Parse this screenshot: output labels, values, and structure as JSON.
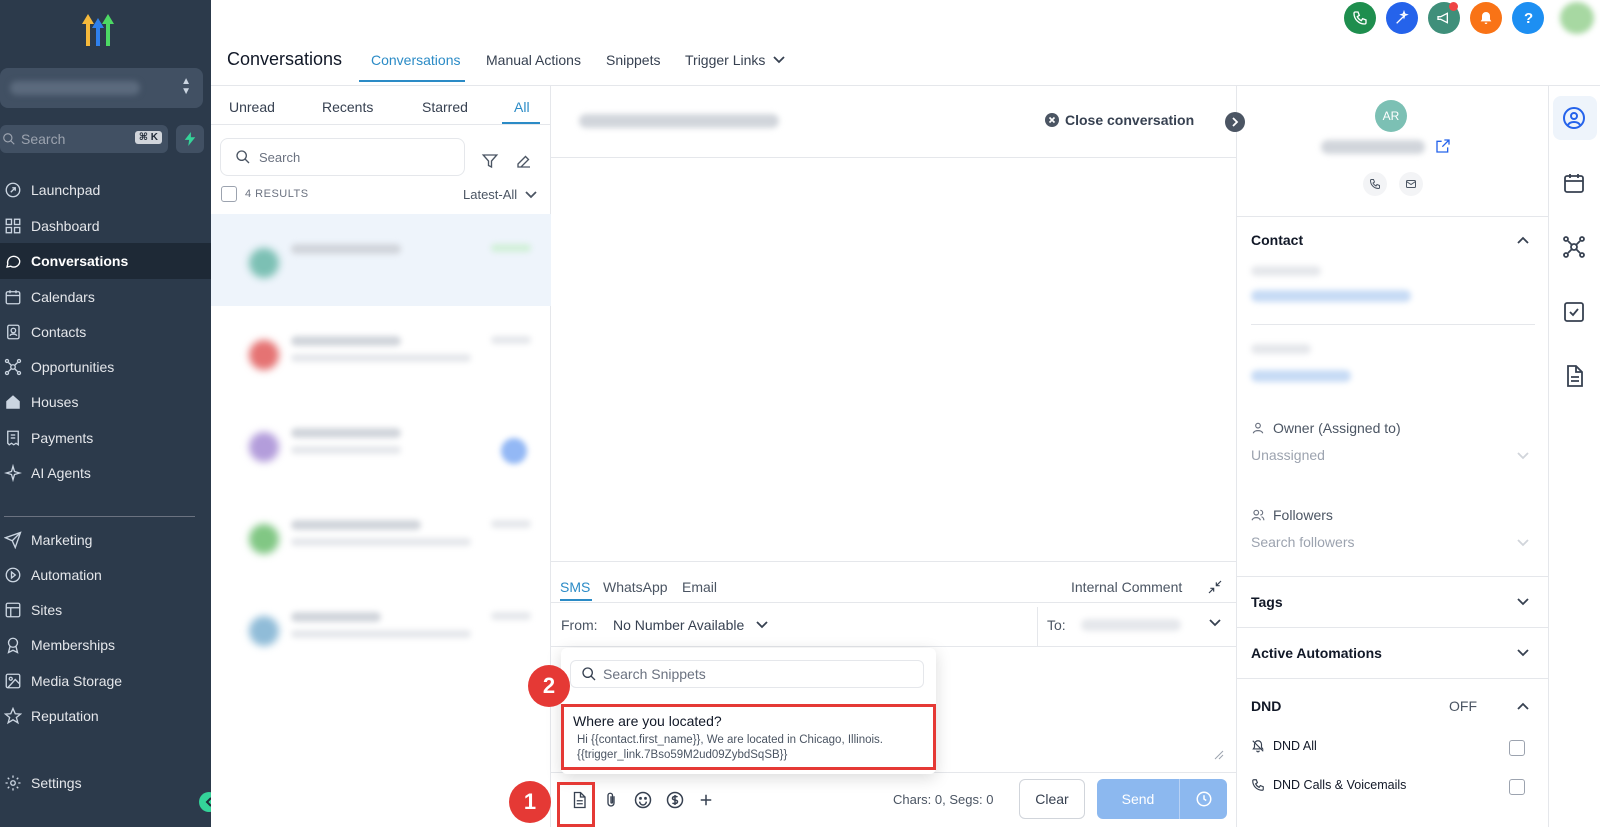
{
  "sidebar": {
    "search_placeholder": "Search",
    "search_shortcut": "⌘ K",
    "items": [
      {
        "label": "Launchpad",
        "icon": "rocket-icon"
      },
      {
        "label": "Dashboard",
        "icon": "grid-icon"
      },
      {
        "label": "Conversations",
        "icon": "chat-icon",
        "active": true
      },
      {
        "label": "Calendars",
        "icon": "calendar-icon"
      },
      {
        "label": "Contacts",
        "icon": "contacts-icon"
      },
      {
        "label": "Opportunities",
        "icon": "network-icon"
      },
      {
        "label": "Houses",
        "icon": "house-icon"
      },
      {
        "label": "Payments",
        "icon": "receipt-icon"
      },
      {
        "label": "AI Agents",
        "icon": "sparkle-icon"
      },
      {
        "label": "Marketing",
        "icon": "send-icon"
      },
      {
        "label": "Automation",
        "icon": "automation-icon"
      },
      {
        "label": "Sites",
        "icon": "sites-icon"
      },
      {
        "label": "Memberships",
        "icon": "badge-icon"
      },
      {
        "label": "Media Storage",
        "icon": "image-icon"
      },
      {
        "label": "Reputation",
        "icon": "star-icon"
      }
    ],
    "settings_label": "Settings"
  },
  "header": {
    "title": "Conversations",
    "tabs": [
      "Conversations",
      "Manual Actions",
      "Snippets",
      "Trigger Links"
    ]
  },
  "colors": {
    "accent": "#2b8bc6",
    "sidebar_bg": "#2c3a4b",
    "annotation_red": "#e53935",
    "send_button": "#8cb8ef"
  },
  "list": {
    "tabs": [
      "Unread",
      "Recents",
      "Starred",
      "All"
    ],
    "search_placeholder": "Search",
    "results": "4 RESULTS",
    "sort": "Latest-All"
  },
  "chat": {
    "close_label": "Close conversation"
  },
  "composer": {
    "tabs": [
      "SMS",
      "WhatsApp",
      "Email"
    ],
    "internal_comment": "Internal Comment",
    "from_label": "From:",
    "from_value": "No Number Available",
    "to_label": "To:",
    "chars": "Chars: 0, Segs: 0",
    "clear": "Clear",
    "send": "Send"
  },
  "snippets": {
    "search_placeholder": "Search Snippets",
    "item_title": "Where are you located?",
    "item_body_1": "Hi {{contact.first_name}}, We are located in Chicago, Illinois.",
    "item_body_2": "{{trigger_link.7Bso59M2ud09ZybdSqSB}}"
  },
  "annotations": {
    "step1": "1",
    "step2": "2"
  },
  "detail": {
    "avatar_initials": "AR",
    "contact": "Contact",
    "owner_label": "Owner (Assigned to)",
    "owner_value": "Unassigned",
    "followers_label": "Followers",
    "followers_placeholder": "Search followers",
    "tags": "Tags",
    "automations": "Active Automations",
    "dnd": "DND",
    "dnd_state": "OFF",
    "dnd_all": "DND All",
    "dnd_calls": "DND Calls & Voicemails"
  }
}
